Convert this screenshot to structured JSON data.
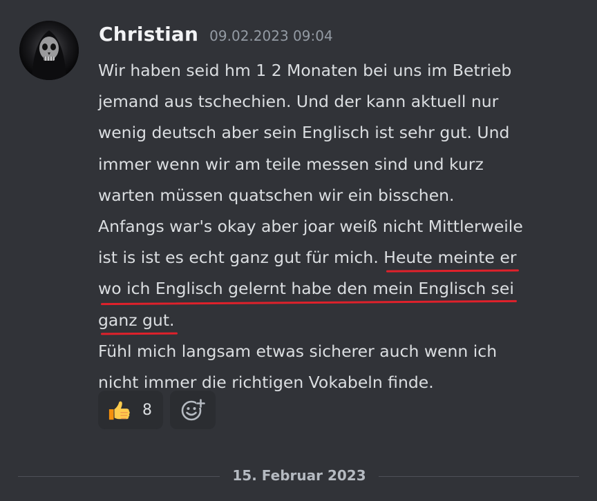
{
  "message": {
    "author": "Christian",
    "timestamp": "09.02.2023 09:04",
    "lines": [
      "Wir haben seid hm 1 2 Monaten bei uns im Betrieb",
      "jemand aus tschechien. Und der kann aktuell nur",
      "wenig deutsch aber sein Englisch ist sehr gut. Und",
      "immer wenn wir am teile messen sind und kurz",
      "warten müssen quatschen wir ein bisschen.",
      "Anfangs war's okay aber joar weiß nicht Mittlerweile"
    ],
    "line7_plain": "ist is ist es echt ganz gut für mich. ",
    "line7_underlined": "Heute meinte er",
    "line8_underlined": "wo ich Englisch gelernt habe den mein Englisch sei",
    "line9_underlined": "ganz gut.",
    "line10": "Fühl mich langsam etwas sicherer auch wenn ich",
    "line11": "nicht immer die richtigen Vokabeln finde.",
    "highlight_color": "#e0212b"
  },
  "reactions": [
    {
      "emoji": "thumbs-up-icon",
      "count": "8"
    }
  ],
  "add_reaction": {
    "icon": "add-reaction-icon"
  },
  "date_divider": {
    "label": "15. Februar 2023"
  },
  "colors": {
    "background": "#313338",
    "username": "#f2f3f5",
    "text": "#dbdee1",
    "timestamp": "#949ba4",
    "reaction_bg": "#2b2d31"
  }
}
